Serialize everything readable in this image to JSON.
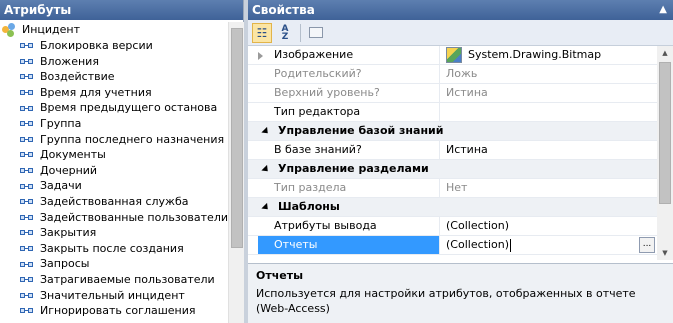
{
  "attributes_panel": {
    "title": "Атрибуты",
    "root_label": "Инцидент",
    "items": [
      "Блокировка версии",
      "Вложения",
      "Воздействие",
      "Время для учетния",
      "Время предыдущего останова",
      "Группа",
      "Группа последнего назначения",
      "Документы",
      "Дочерний",
      "Задачи",
      "Задействованная служба",
      "Задействованные пользователи",
      "Закрытия",
      "Закрыть после создания",
      "Запросы",
      "Затрагиваемые пользователи",
      "Значительный инцидент",
      "Игнорировать соглашения"
    ]
  },
  "properties_panel": {
    "title": "Свойства",
    "collapse_icon": "double-chevron-up-icon",
    "toolbar": {
      "categorized_icon": "categorized-icon",
      "alphabetical_icon": "sort-az-icon",
      "property_pages_icon": "property-pages-icon"
    },
    "rows": [
      {
        "kind": "prop",
        "name": "Изображение",
        "value": "System.Drawing.Bitmap",
        "disabled": false,
        "expandable": true,
        "icon": "bitmap-icon"
      },
      {
        "kind": "prop",
        "name": "Родительский?",
        "value": "Ложь",
        "disabled": true
      },
      {
        "kind": "prop",
        "name": "Верхний уровень?",
        "value": "Истина",
        "disabled": true
      },
      {
        "kind": "prop",
        "name": "Тип редактора",
        "value": "",
        "disabled": false
      },
      {
        "kind": "cat",
        "name": "Управление базой знаний"
      },
      {
        "kind": "prop",
        "name": "В базе знаний?",
        "value": "Истина",
        "disabled": false
      },
      {
        "kind": "cat",
        "name": "Управление разделами"
      },
      {
        "kind": "prop",
        "name": "Тип раздела",
        "value": "Нет",
        "disabled": true
      },
      {
        "kind": "cat",
        "name": "Шаблоны"
      },
      {
        "kind": "prop",
        "name": "Атрибуты вывода",
        "value": "(Collection)",
        "disabled": false
      },
      {
        "kind": "prop",
        "name": "Отчеты",
        "value": "(Collection)",
        "disabled": false,
        "selected": true,
        "edit_button": "..."
      }
    ],
    "description": {
      "title": "Отчеты",
      "text": "Используется для настройки атрибутов, отображенных в отчете (Web-Access)"
    }
  }
}
